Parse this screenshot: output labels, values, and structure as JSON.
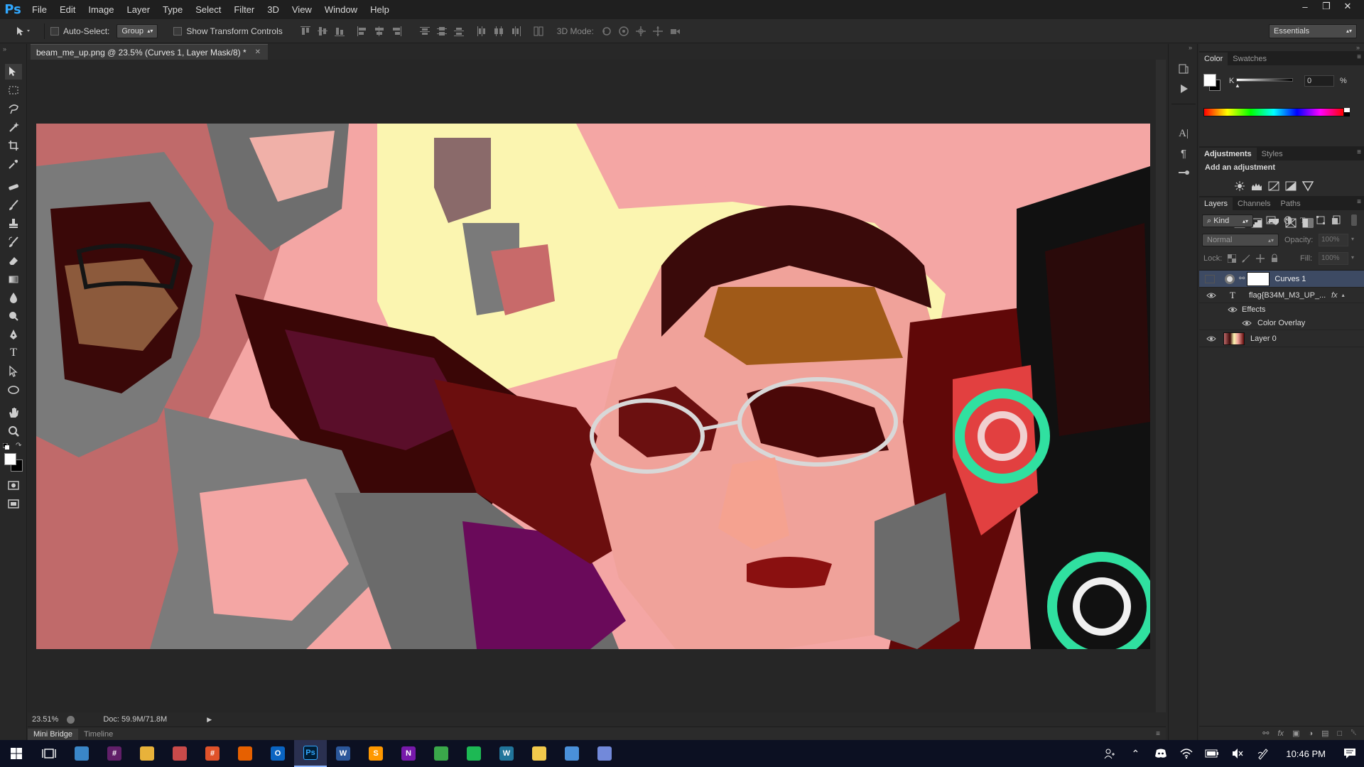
{
  "app": {
    "logo": "Ps"
  },
  "menu": [
    "File",
    "Edit",
    "Image",
    "Layer",
    "Type",
    "Select",
    "Filter",
    "3D",
    "View",
    "Window",
    "Help"
  ],
  "window_controls": {
    "minimize": "–",
    "restore": "❐",
    "close": "✕"
  },
  "options_bar": {
    "auto_select_label": "Auto-Select:",
    "auto_select_value": "Group",
    "transform_label": "Show Transform Controls",
    "mode_3d_label": "3D Mode:",
    "workspace": "Essentials"
  },
  "document": {
    "tab_title": "beam_me_up.png @ 23.5% (Curves 1, Layer Mask/8) *",
    "zoom": "23.51%",
    "doc_size": "Doc: 59.9M/71.8M"
  },
  "bottom_tabs": [
    "Mini Bridge",
    "Timeline"
  ],
  "color_panel": {
    "tabs": [
      "Color",
      "Swatches"
    ],
    "channel": "K",
    "value": "0",
    "unit": "%"
  },
  "adjustments_panel": {
    "tabs": [
      "Adjustments",
      "Styles"
    ],
    "heading": "Add an adjustment"
  },
  "layers_panel": {
    "tabs": [
      "Layers",
      "Channels",
      "Paths"
    ],
    "filter_kind": "Kind",
    "blend_mode": "Normal",
    "opacity_label": "Opacity:",
    "opacity_value": "100%",
    "lock_label": "Lock:",
    "fill_label": "Fill:",
    "fill_value": "100%",
    "layers": [
      {
        "name": "Curves 1"
      },
      {
        "name": "flag{B34M_M3_UP_...",
        "type_icon": "T"
      },
      {
        "name": "Effects"
      },
      {
        "name": "Color Overlay"
      },
      {
        "name": "Layer 0"
      }
    ]
  },
  "taskbar": {
    "time": "10:46 PM",
    "apps": [
      {
        "icon": "explorer-window-icon",
        "color": "#3a86c8",
        "glyph": ""
      },
      {
        "icon": "slack-icon",
        "color": "#611f69",
        "glyph": "#"
      },
      {
        "icon": "file-explorer-icon",
        "color": "#e8b23a",
        "glyph": ""
      },
      {
        "icon": "paint-icon",
        "color": "#c94a4a",
        "glyph": ""
      },
      {
        "icon": "hashtag-app-icon",
        "color": "#e0522a",
        "glyph": "#"
      },
      {
        "icon": "firefox-icon",
        "color": "#e66000",
        "glyph": ""
      },
      {
        "icon": "outlook-icon",
        "color": "#0a64c2",
        "glyph": "O"
      },
      {
        "icon": "photoshop-icon",
        "color": "#001e36",
        "glyph": "Ps"
      },
      {
        "icon": "word-icon",
        "color": "#2b579a",
        "glyph": "W"
      },
      {
        "icon": "sublime-icon",
        "color": "#ff9800",
        "glyph": "S"
      },
      {
        "icon": "onenote-icon",
        "color": "#7719aa",
        "glyph": "N"
      },
      {
        "icon": "maps-icon",
        "color": "#3aa84a",
        "glyph": ""
      },
      {
        "icon": "spotify-icon",
        "color": "#1db954",
        "glyph": ""
      },
      {
        "icon": "wordpress-icon",
        "color": "#21759b",
        "glyph": "W"
      },
      {
        "icon": "gallery-icon",
        "color": "#f2c94c",
        "glyph": ""
      },
      {
        "icon": "store-icon",
        "color": "#4a90d9",
        "glyph": ""
      },
      {
        "icon": "discord-icon",
        "color": "#7289da",
        "glyph": ""
      }
    ]
  }
}
